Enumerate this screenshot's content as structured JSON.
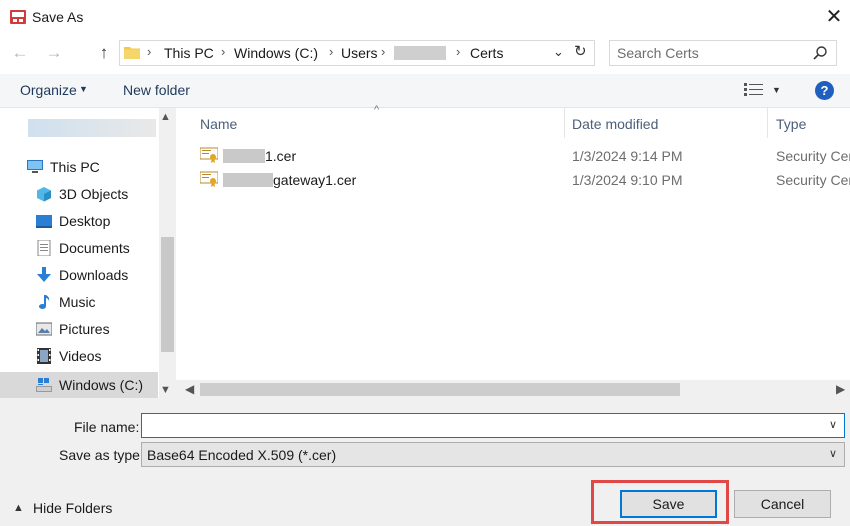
{
  "window": {
    "title": "Save As",
    "close_glyph": "✕"
  },
  "nav_buttons": {
    "back": "←",
    "forward": "→",
    "up": "↑"
  },
  "address": {
    "crumbs": [
      "This PC",
      "Windows (C:)",
      "Users",
      "Certs"
    ],
    "separator": "›",
    "dropdown_glyph": "⌄",
    "refresh_glyph": "↻"
  },
  "search": {
    "placeholder": "Search Certs"
  },
  "toolbar": {
    "organize": "Organize",
    "new_folder": "New folder",
    "help": "?"
  },
  "nav_pane": {
    "items": [
      {
        "label": "This PC",
        "icon": "computer-icon"
      },
      {
        "label": "3D Objects",
        "icon": "cube-icon"
      },
      {
        "label": "Desktop",
        "icon": "desktop-icon"
      },
      {
        "label": "Documents",
        "icon": "document-icon"
      },
      {
        "label": "Downloads",
        "icon": "download-icon"
      },
      {
        "label": "Music",
        "icon": "music-icon"
      },
      {
        "label": "Pictures",
        "icon": "picture-icon"
      },
      {
        "label": "Videos",
        "icon": "video-icon"
      },
      {
        "label": "Windows (C:)",
        "icon": "drive-icon"
      }
    ],
    "selected": "Windows (C:)"
  },
  "file_list": {
    "columns": [
      "Name",
      "Date modified",
      "Type"
    ],
    "rows": [
      {
        "name": "1.cer",
        "date": "1/3/2024 9:14 PM",
        "type": "Security Cert"
      },
      {
        "name": "gateway1.cer",
        "date": "1/3/2024 9:10 PM",
        "type": "Security Cert"
      }
    ]
  },
  "fields": {
    "file_name_label": "File name:",
    "file_name_value": "",
    "save_type_label": "Save as type:",
    "save_type_value": "Base64 Encoded X.509 (*.cer)"
  },
  "footer": {
    "hide_folders": "Hide Folders",
    "save": "Save",
    "cancel": "Cancel"
  },
  "colors": {
    "accent": "#0078d7",
    "highlight": "#e04848"
  }
}
